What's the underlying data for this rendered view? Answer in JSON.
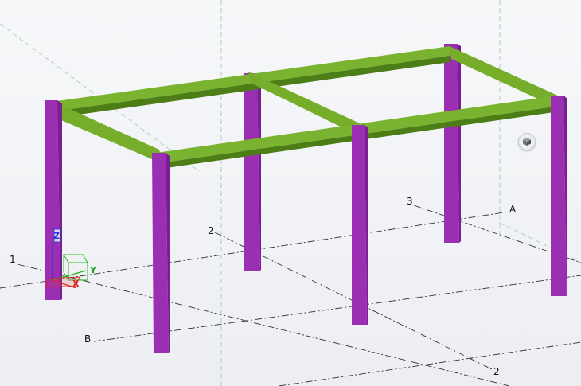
{
  "grid_labels": {
    "g1": "1",
    "g2_top": "2",
    "g3": "3",
    "gA": "A",
    "gB": "B",
    "g2_bottom": "2"
  },
  "axes": {
    "z": "Z",
    "y": "Y",
    "x": "X"
  },
  "colors": {
    "column": "#9b2fb4",
    "column_dark": "#7a1f92",
    "beam": "#6aa524",
    "beam_dark": "#4d7d17",
    "gridline": "#333333",
    "axis_x": "#e02020",
    "axis_y": "#20b020",
    "axis_z": "#3030e0"
  },
  "icons": {
    "viewcube": "cube-icon"
  }
}
